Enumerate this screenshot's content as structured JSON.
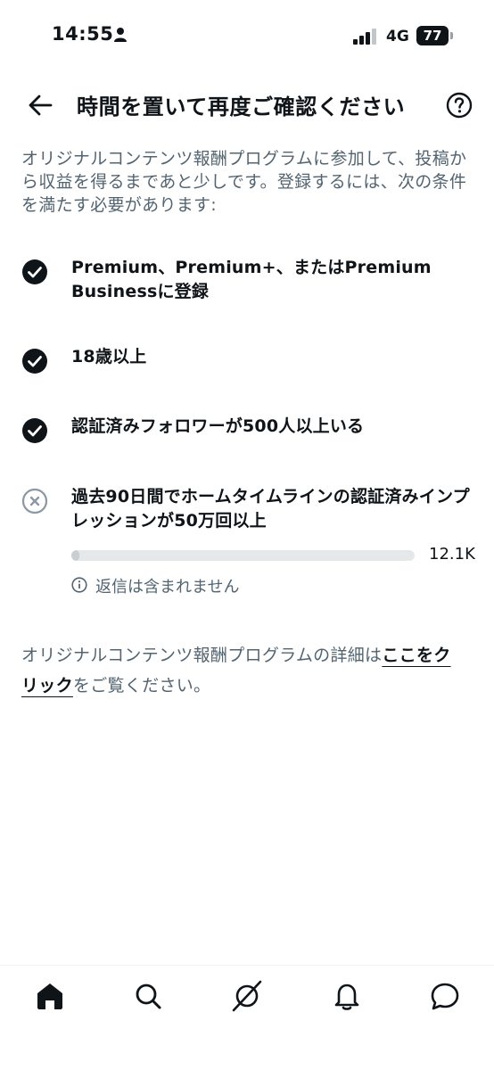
{
  "status_bar": {
    "time": "14:55",
    "network": "4G",
    "battery": "77"
  },
  "header": {
    "title": "時間を置いて再度ご確認ください"
  },
  "intro": "オリジナルコンテンツ報酬プログラムに参加して、投稿から収益を得るまであと少しです。登録するには、次の条件を満たす必要があります:",
  "requirements": [
    {
      "text": "Premium、Premium+、またはPremium Businessに登録",
      "status": "met"
    },
    {
      "text": "18歳以上",
      "status": "met"
    },
    {
      "text": "認証済みフォロワーが500人以上いる",
      "status": "met"
    },
    {
      "text": "過去90日間でホームタイムラインの認証済みインプレッションが50万回以上",
      "status": "unmet"
    }
  ],
  "impressions_progress": {
    "value_label": "12.1K",
    "fraction": 0.024
  },
  "note": "返信は含まれません",
  "details": {
    "prefix": "オリジナルコンテンツ報酬プログラムの詳細は",
    "link": "ここをクリック",
    "suffix": "をご覧ください。"
  },
  "colors": {
    "text_primary": "#0f1419",
    "text_secondary": "#536471",
    "progress_track": "#e5e7e9"
  },
  "nav_icons": [
    "home-icon",
    "search-icon",
    "grok-icon",
    "bell-icon",
    "messages-icon"
  ]
}
